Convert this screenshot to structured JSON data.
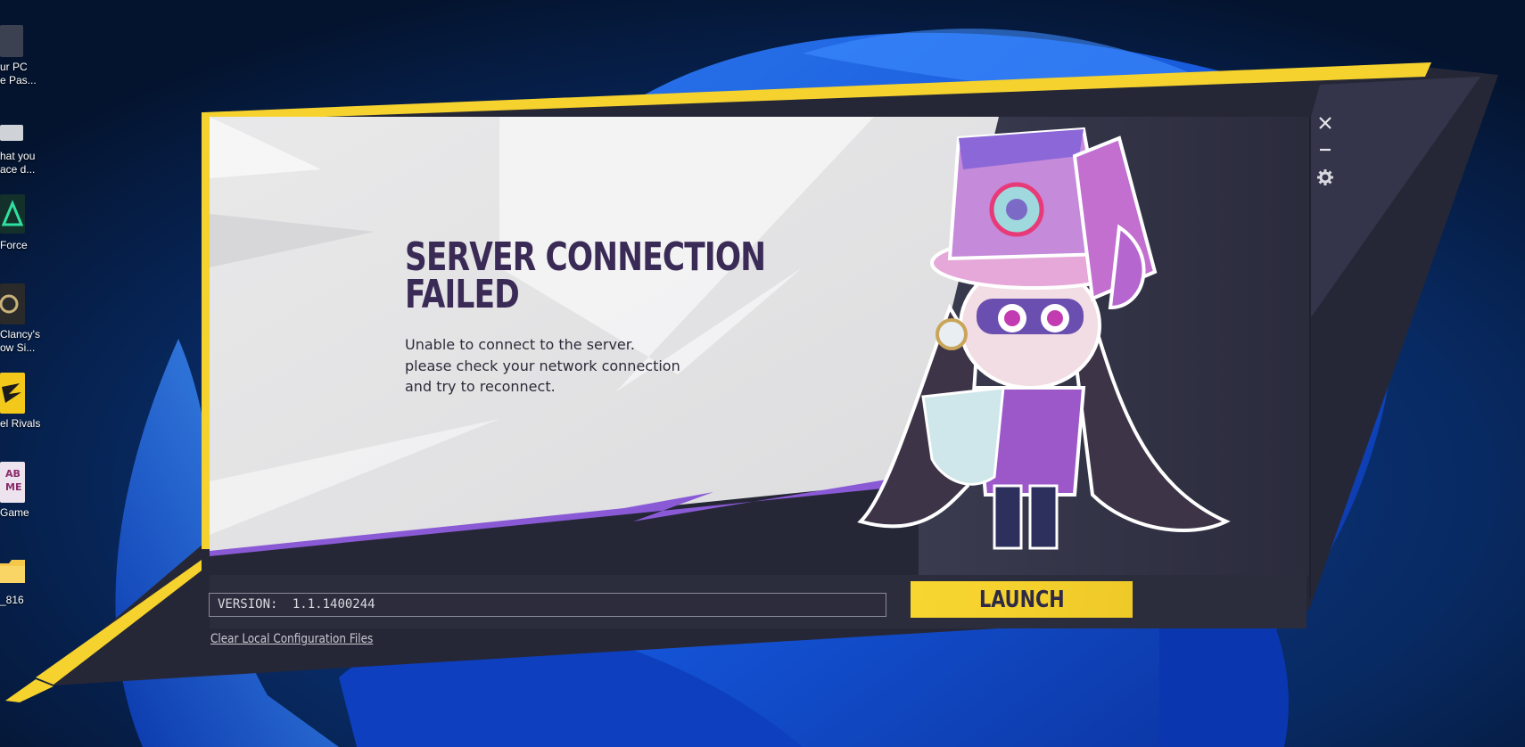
{
  "desktop": {
    "icons": [
      {
        "label_line1": "ur PC",
        "label_line2": "e Pas..."
      },
      {
        "label_line1": "hat you",
        "label_line2": "ace d..."
      },
      {
        "label_line1": "Force",
        "label_line2": ""
      },
      {
        "label_line1": "Clancy's",
        "label_line2": "ow Si..."
      },
      {
        "label_line1": "el Rivals",
        "label_line2": ""
      },
      {
        "label_line1": "Game",
        "label_line2": ""
      },
      {
        "label_line1": "_816",
        "label_line2": ""
      }
    ],
    "thumb_text": {
      "lab": "AB",
      "me": "ME"
    }
  },
  "dialog": {
    "title_line1": "SERVER CONNECTION",
    "title_line2": "FAILED",
    "message_lines": [
      "Unable to connect to the server.",
      "please check your network connection",
      "and try to reconnect."
    ]
  },
  "footer": {
    "version_label": "VERSION:",
    "version_value": "1.1.1400244",
    "launch_label": "LAUNCH",
    "clear_link": "Clear Local Configuration Files"
  },
  "window_controls": {
    "close": "close-icon",
    "minimize": "minimize-icon",
    "settings": "gear-icon"
  },
  "colors": {
    "accent_yellow": "#f5d22e",
    "accent_purple": "#8a5ad6",
    "panel_light": "#e4e4e6",
    "frame_dark": "#2b2c3c",
    "title_text": "#3a2a56"
  }
}
